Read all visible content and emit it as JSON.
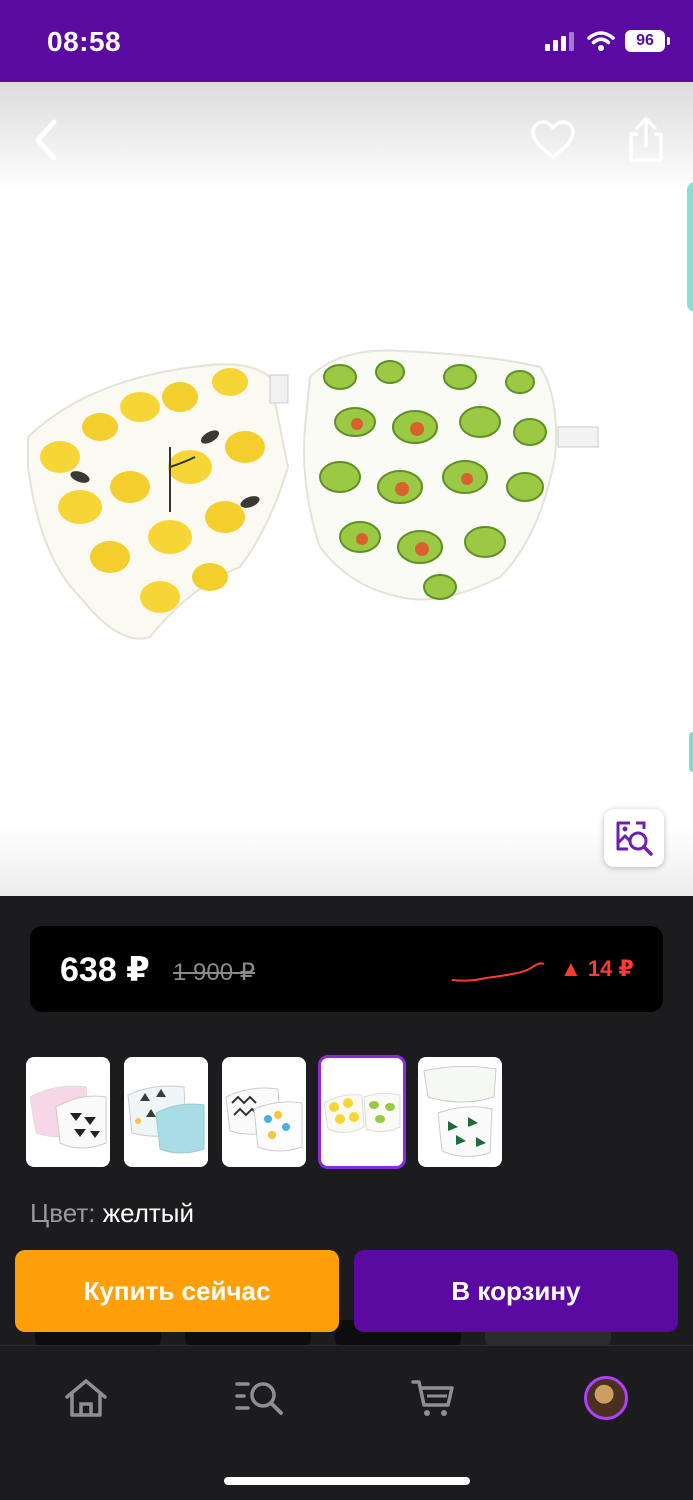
{
  "status_bar": {
    "time": "08:58",
    "battery": "96"
  },
  "product": {
    "price_current": "638 ₽",
    "price_old": "1 900 ₽",
    "price_change": "▲ 14 ₽",
    "color_label": "Цвет:",
    "color_value": "желтый",
    "thumbnail_count": 5,
    "selected_thumbnail": 4
  },
  "actions": {
    "buy_now": "Купить сейчас",
    "add_to_cart": "В корзину"
  },
  "icons": {
    "back": "chevron-left-icon",
    "favorite": "heart-icon",
    "share": "share-icon",
    "image_search": "image-search-icon",
    "tabs": [
      "home-icon",
      "catalog-search-icon",
      "cart-icon",
      "profile-avatar"
    ]
  },
  "colors": {
    "brand_purple": "#5a0aa0",
    "buy_orange": "#ff9f0a",
    "price_change_red": "#ff3b30"
  }
}
